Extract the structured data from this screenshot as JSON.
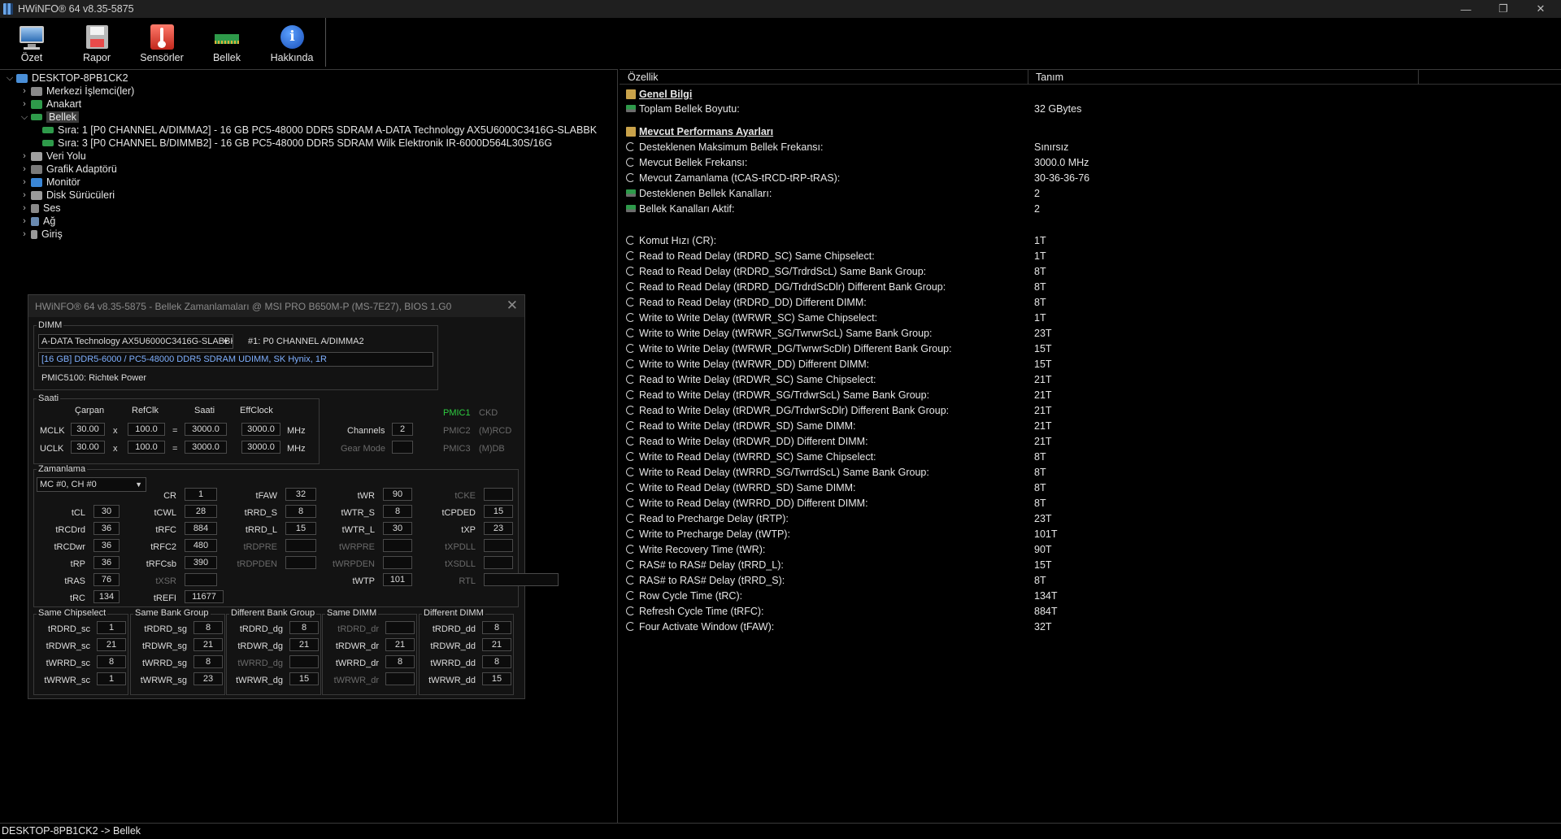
{
  "window": {
    "title": "HWiNFO® 64 v8.35-5875",
    "minimize": "—",
    "maximize": "❐",
    "close": "✕"
  },
  "toolbar": {
    "items": [
      {
        "label": "Özet",
        "icon": "monitor-icon"
      },
      {
        "label": "Rapor",
        "icon": "save-icon"
      },
      {
        "label": "Sensörler",
        "icon": "thermometer-icon"
      },
      {
        "label": "Bellek",
        "icon": "memory-icon"
      },
      {
        "label": "Hakkında",
        "icon": "info-icon"
      }
    ]
  },
  "tree": {
    "root": "DESKTOP-8PB1CK2",
    "items": [
      {
        "label": "Merkezi İşlemci(ler)"
      },
      {
        "label": "Anakart"
      },
      {
        "label": "Bellek"
      },
      {
        "label": "Sıra: 1 [P0 CHANNEL A/DIMMA2] - 16 GB PC5-48000 DDR5 SDRAM A-DATA Technology AX5U6000C3416G-SLABBK"
      },
      {
        "label": "Sıra: 3 [P0 CHANNEL B/DIMMB2] - 16 GB PC5-48000 DDR5 SDRAM Wilk Elektronik IR-6000D564L30S/16G"
      },
      {
        "label": "Veri Yolu"
      },
      {
        "label": "Grafik Adaptörü"
      },
      {
        "label": "Monitör"
      },
      {
        "label": "Disk Sürücüleri"
      },
      {
        "label": "Ses"
      },
      {
        "label": "Ağ"
      },
      {
        "label": "Giriş"
      }
    ]
  },
  "properties": {
    "col_feature": "Özellik",
    "col_value": "Tanım",
    "rows": [
      {
        "name": "Genel Bilgi",
        "value": ""
      },
      {
        "name": "Toplam Bellek Boyutu:",
        "value": "32 GBytes"
      },
      {
        "name": "Mevcut Performans Ayarları",
        "value": ""
      },
      {
        "name": "Desteklenen Maksimum Bellek Frekansı:",
        "value": "Sınırsız"
      },
      {
        "name": "Mevcut Bellek Frekansı:",
        "value": "3000.0 MHz"
      },
      {
        "name": "Mevcut Zamanlama (tCAS-tRCD-tRP-tRAS):",
        "value": "30-36-36-76"
      },
      {
        "name": "Desteklenen Bellek Kanalları:",
        "value": "2"
      },
      {
        "name": "Bellek Kanalları Aktif:",
        "value": "2"
      },
      {
        "name": "Komut Hızı (CR):",
        "value": "1T"
      },
      {
        "name": "Read to Read Delay (tRDRD_SC) Same Chipselect:",
        "value": "1T"
      },
      {
        "name": "Read to Read Delay (tRDRD_SG/TrdrdScL) Same Bank Group:",
        "value": "8T"
      },
      {
        "name": "Read to Read Delay (tRDRD_DG/TrdrdScDlr) Different Bank Group:",
        "value": "8T"
      },
      {
        "name": "Read to Read Delay (tRDRD_DD) Different DIMM:",
        "value": "8T"
      },
      {
        "name": "Write to Write Delay (tWRWR_SC) Same Chipselect:",
        "value": "1T"
      },
      {
        "name": "Write to Write Delay (tWRWR_SG/TwrwrScL) Same Bank Group:",
        "value": "23T"
      },
      {
        "name": "Write to Write Delay (tWRWR_DG/TwrwrScDlr) Different Bank Group:",
        "value": "15T"
      },
      {
        "name": "Write to Write Delay (tWRWR_DD) Different DIMM:",
        "value": "15T"
      },
      {
        "name": "Read to Write Delay (tRDWR_SC) Same Chipselect:",
        "value": "21T"
      },
      {
        "name": "Read to Write Delay (tRDWR_SG/TrdwrScL) Same Bank Group:",
        "value": "21T"
      },
      {
        "name": "Read to Write Delay (tRDWR_DG/TrdwrScDlr) Different Bank Group:",
        "value": "21T"
      },
      {
        "name": "Read to Write Delay (tRDWR_SD) Same DIMM:",
        "value": "21T"
      },
      {
        "name": "Read to Write Delay (tRDWR_DD) Different DIMM:",
        "value": "21T"
      },
      {
        "name": "Write to Read Delay (tWRRD_SC) Same Chipselect:",
        "value": "8T"
      },
      {
        "name": "Write to Read Delay (tWRRD_SG/TwrrdScL) Same Bank Group:",
        "value": "8T"
      },
      {
        "name": "Write to Read Delay (tWRRD_SD) Same DIMM:",
        "value": "8T"
      },
      {
        "name": "Write to Read Delay (tWRRD_DD) Different DIMM:",
        "value": "8T"
      },
      {
        "name": "Read to Precharge Delay (tRTP):",
        "value": "23T"
      },
      {
        "name": "Write to Precharge Delay (tWTP):",
        "value": "101T"
      },
      {
        "name": "Write Recovery Time (tWR):",
        "value": "90T"
      },
      {
        "name": "RAS# to RAS# Delay (tRRD_L):",
        "value": "15T"
      },
      {
        "name": "RAS# to RAS# Delay (tRRD_S):",
        "value": "8T"
      },
      {
        "name": "Row Cycle Time (tRC):",
        "value": "134T"
      },
      {
        "name": "Refresh Cycle Time (tRFC):",
        "value": "884T"
      },
      {
        "name": "Four Activate Window (tFAW):",
        "value": "32T"
      }
    ]
  },
  "dialog": {
    "title": "HWiNFO® 64 v8.35-5875 - Bellek Zamanlamaları @ MSI PRO B650M-P (MS-7E27), BIOS 1.G0",
    "close": "✕",
    "dimm": {
      "label": "DIMM",
      "module": "A-DATA Technology AX5U6000C3416G-SLABBK",
      "slot": "#1: P0 CHANNEL A/DIMMA2",
      "desc": "[16 GB] DDR5-6000 / PC5-48000 DDR5 SDRAM UDIMM, SK Hynix, 1R",
      "pmic": "PMIC5100: Richtek Power"
    },
    "clock": {
      "label": "Saati",
      "h_mult": "Çarpan",
      "h_ref": "RefClk",
      "h_clock": "Saati",
      "h_eff": "EffClock",
      "mclk": {
        "name": "MCLK",
        "mult": "30.00",
        "x": "x",
        "ref": "100.0",
        "eq": "=",
        "clock": "3000.0",
        "eff": "3000.0",
        "unit": "MHz"
      },
      "uclk": {
        "name": "UCLK",
        "mult": "30.00",
        "x": "x",
        "ref": "100.0",
        "eq": "=",
        "clock": "3000.0",
        "eff": "3000.0",
        "unit": "MHz"
      },
      "channels_label": "Channels",
      "channels": "2",
      "gear_label": "Gear Mode",
      "gear": "",
      "pmic1": "PMIC1",
      "ckd": "CKD",
      "pmic2": "PMIC2",
      "mrcd": "(M)RCD",
      "pmic3": "PMIC3",
      "mdb": "(M)DB"
    },
    "timing": {
      "label": "Zamanlama",
      "mc": "MC #0, CH #0",
      "cells": [
        {
          "n": "CR",
          "v": "1"
        },
        {
          "n": "tFAW",
          "v": "32"
        },
        {
          "n": "tWR",
          "v": "90"
        },
        {
          "n": "tCKE",
          "v": ""
        },
        {
          "n": "tCL",
          "v": "30"
        },
        {
          "n": "tCWL",
          "v": "28"
        },
        {
          "n": "tRRD_S",
          "v": "8"
        },
        {
          "n": "tWTR_S",
          "v": "8"
        },
        {
          "n": "tCPDED",
          "v": "15"
        },
        {
          "n": "tRCDrd",
          "v": "36"
        },
        {
          "n": "tRFC",
          "v": "884"
        },
        {
          "n": "tRRD_L",
          "v": "15"
        },
        {
          "n": "tWTR_L",
          "v": "30"
        },
        {
          "n": "tXP",
          "v": "23"
        },
        {
          "n": "tRCDwr",
          "v": "36"
        },
        {
          "n": "tRFC2",
          "v": "480"
        },
        {
          "n": "tRDPRE",
          "v": ""
        },
        {
          "n": "tWRPRE",
          "v": ""
        },
        {
          "n": "tXPDLL",
          "v": ""
        },
        {
          "n": "tRP",
          "v": "36"
        },
        {
          "n": "tRFCsb",
          "v": "390"
        },
        {
          "n": "tRDPDEN",
          "v": ""
        },
        {
          "n": "tWRPDEN",
          "v": ""
        },
        {
          "n": "tXSDLL",
          "v": ""
        },
        {
          "n": "tRAS",
          "v": "76"
        },
        {
          "n": "tXSR",
          "v": ""
        },
        {
          "n": "tWTP",
          "v": "101"
        },
        {
          "n": "RTL",
          "v": ""
        },
        {
          "n": "tRC",
          "v": "134"
        },
        {
          "n": "tREFI",
          "v": "11677"
        }
      ]
    },
    "groups": [
      {
        "title": "Same Chipselect",
        "rows": [
          {
            "n": "tRDRD_sc",
            "v": "1"
          },
          {
            "n": "tRDWR_sc",
            "v": "21"
          },
          {
            "n": "tWRRD_sc",
            "v": "8"
          },
          {
            "n": "tWRWR_sc",
            "v": "1"
          }
        ]
      },
      {
        "title": "Same Bank Group",
        "rows": [
          {
            "n": "tRDRD_sg",
            "v": "8"
          },
          {
            "n": "tRDWR_sg",
            "v": "21"
          },
          {
            "n": "tWRRD_sg",
            "v": "8"
          },
          {
            "n": "tWRWR_sg",
            "v": "23"
          }
        ]
      },
      {
        "title": "Different Bank Group",
        "rows": [
          {
            "n": "tRDRD_dg",
            "v": "8"
          },
          {
            "n": "tRDWR_dg",
            "v": "21"
          },
          {
            "n": "tWRRD_dg",
            "v": ""
          },
          {
            "n": "tWRWR_dg",
            "v": "15"
          }
        ]
      },
      {
        "title": "Same DIMM",
        "rows": [
          {
            "n": "tRDRD_dr",
            "v": ""
          },
          {
            "n": "tRDWR_dr",
            "v": "21"
          },
          {
            "n": "tWRRD_dr",
            "v": "8"
          },
          {
            "n": "tWRWR_dr",
            "v": ""
          }
        ]
      },
      {
        "title": "Different DIMM",
        "rows": [
          {
            "n": "tRDRD_dd",
            "v": "8"
          },
          {
            "n": "tRDWR_dd",
            "v": "21"
          },
          {
            "n": "tWRRD_dd",
            "v": "8"
          },
          {
            "n": "tWRWR_dd",
            "v": "15"
          }
        ]
      }
    ]
  },
  "status": {
    "text": "DESKTOP-8PB1CK2 -> Bellek"
  }
}
